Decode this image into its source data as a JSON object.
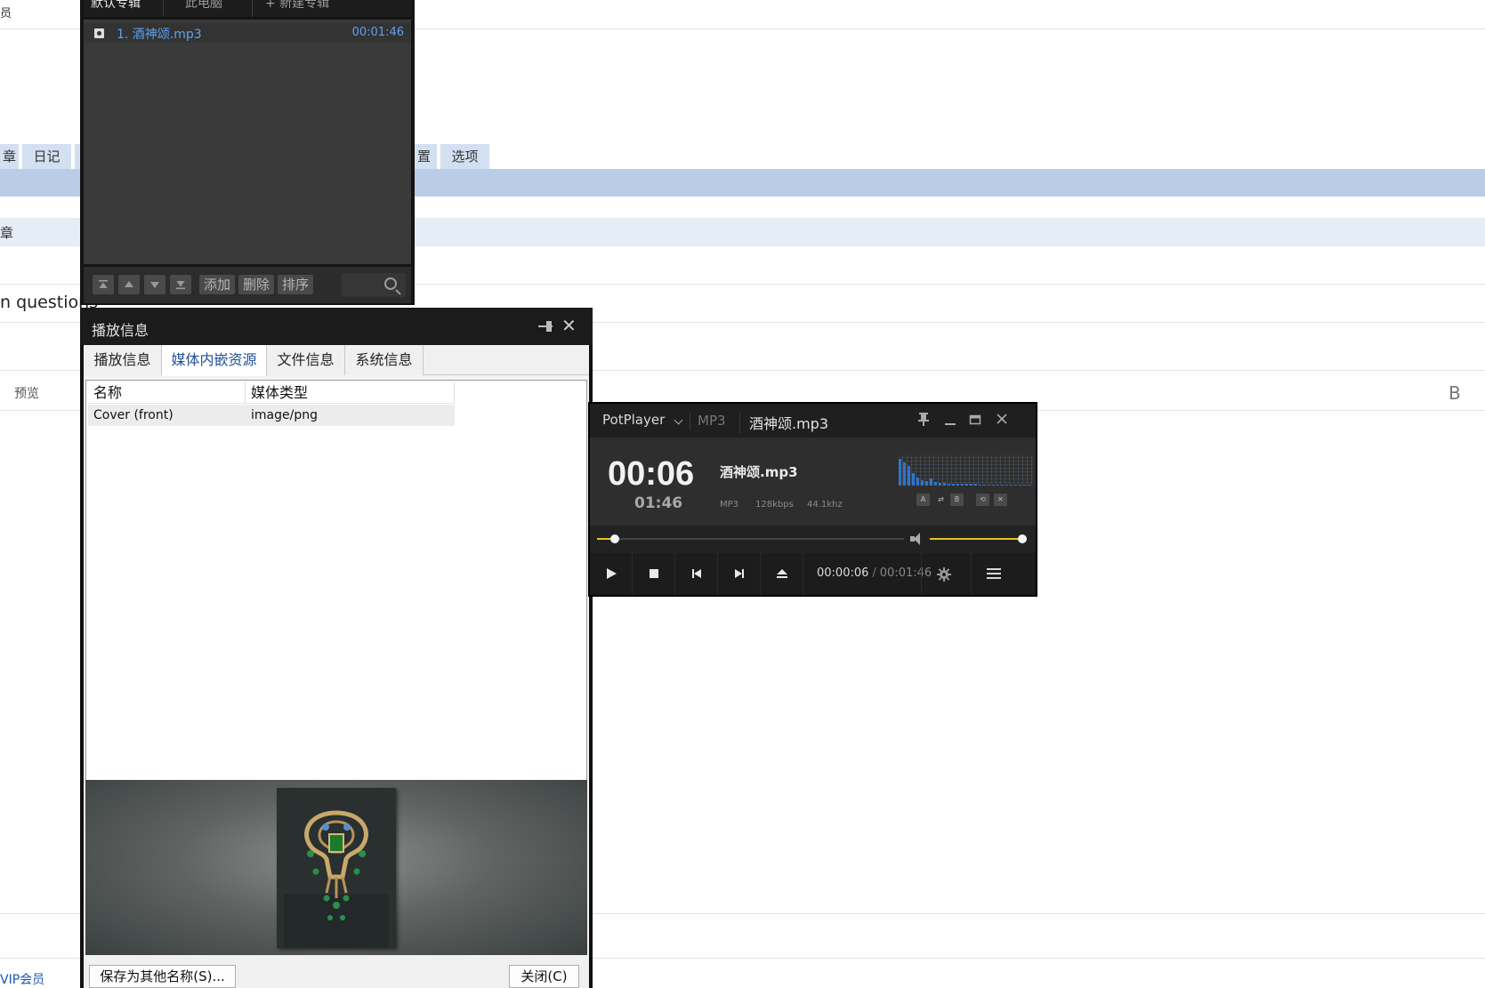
{
  "background": {
    "top_left_text": "员",
    "tabs": [
      "章",
      "日记",
      "置",
      "选项"
    ],
    "band_label": "章",
    "question_text": "n questions",
    "preview_label": "预览",
    "bold_button": "B",
    "bottom_link": "VIP会员"
  },
  "playlist": {
    "tabs": [
      "默认专辑",
      "此电脑",
      "+ 新建专辑"
    ],
    "items": [
      {
        "name": "1. 酒神颂.mp3",
        "duration": "00:01:46"
      }
    ],
    "buttons": {
      "add": "添加",
      "delete": "删除",
      "sort": "排序"
    }
  },
  "info_dialog": {
    "title": "播放信息",
    "tabs": [
      "播放信息",
      "媒体内嵌资源",
      "文件信息",
      "系统信息"
    ],
    "selected_tab": "媒体内嵌资源",
    "columns": [
      "名称",
      "媒体类型"
    ],
    "rows": [
      {
        "name": "Cover (front)",
        "type": "image/png"
      }
    ],
    "save_as_button": "保存为其他名称(S)...",
    "close_button": "关闭(C)"
  },
  "player": {
    "brand": "PotPlayer",
    "format": "MP3",
    "title": "酒神颂.mp3",
    "current_time": "00:06",
    "total_time": "01:46",
    "filename": "酒神颂.mp3",
    "meta": {
      "codec": "MP3",
      "bitrate": "128kbps",
      "samplerate": "44.1khz"
    },
    "time_current": "00:00:06",
    "time_separator": "/",
    "time_total": "00:01:46",
    "seek_fraction": 0.057,
    "volume_fraction": 1.0,
    "accent_color": "#e8c020",
    "spectrum_color": "#2f74d0"
  }
}
